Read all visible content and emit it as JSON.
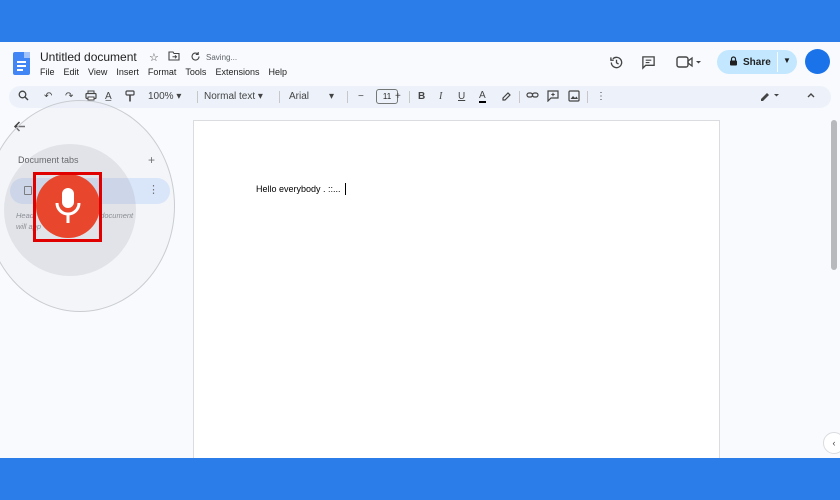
{
  "header": {
    "doc_title": "Untitled document",
    "saving_status": "Saving...",
    "menu": [
      "File",
      "Edit",
      "View",
      "Insert",
      "Format",
      "Tools",
      "Extensions",
      "Help"
    ],
    "share_label": "Share"
  },
  "toolbar": {
    "zoom": "100%",
    "style": "Normal text",
    "font": "Arial",
    "font_size": "11"
  },
  "sidebar": {
    "section_title": "Document tabs",
    "hint_line1": "Head",
    "hint_line1_end": "e document",
    "hint_line2": "will app"
  },
  "document": {
    "text": "Hello everybody . ::..."
  },
  "colors": {
    "outer_border": "#2b7de9",
    "share_bg": "#c2e7ff",
    "mic": "#e8472e",
    "highlight_box": "#e00000",
    "tab_selected": "#d3e3fd"
  }
}
